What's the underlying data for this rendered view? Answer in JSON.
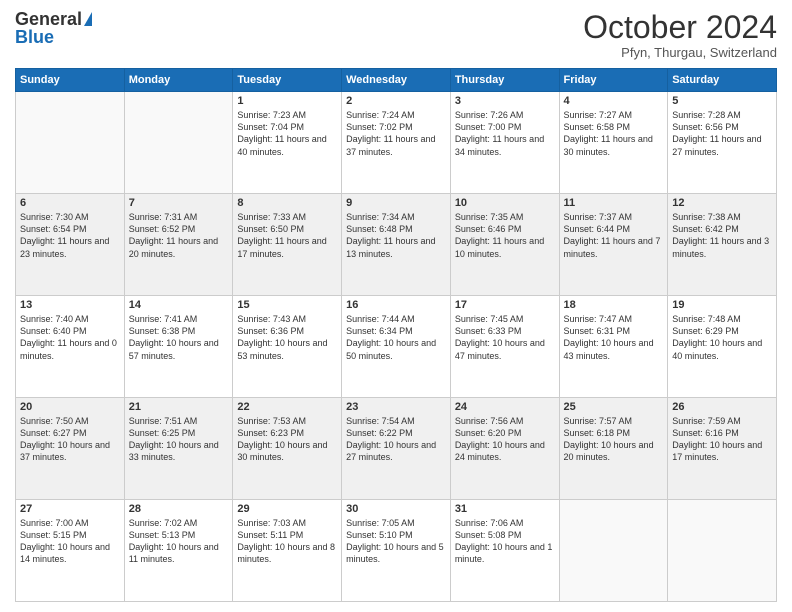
{
  "logo": {
    "general": "General",
    "blue": "Blue"
  },
  "header": {
    "month": "October 2024",
    "location": "Pfyn, Thurgau, Switzerland"
  },
  "weekdays": [
    "Sunday",
    "Monday",
    "Tuesday",
    "Wednesday",
    "Thursday",
    "Friday",
    "Saturday"
  ],
  "weeks": [
    [
      {
        "day": "",
        "info": ""
      },
      {
        "day": "",
        "info": ""
      },
      {
        "day": "1",
        "info": "Sunrise: 7:23 AM\nSunset: 7:04 PM\nDaylight: 11 hours and 40 minutes."
      },
      {
        "day": "2",
        "info": "Sunrise: 7:24 AM\nSunset: 7:02 PM\nDaylight: 11 hours and 37 minutes."
      },
      {
        "day": "3",
        "info": "Sunrise: 7:26 AM\nSunset: 7:00 PM\nDaylight: 11 hours and 34 minutes."
      },
      {
        "day": "4",
        "info": "Sunrise: 7:27 AM\nSunset: 6:58 PM\nDaylight: 11 hours and 30 minutes."
      },
      {
        "day": "5",
        "info": "Sunrise: 7:28 AM\nSunset: 6:56 PM\nDaylight: 11 hours and 27 minutes."
      }
    ],
    [
      {
        "day": "6",
        "info": "Sunrise: 7:30 AM\nSunset: 6:54 PM\nDaylight: 11 hours and 23 minutes."
      },
      {
        "day": "7",
        "info": "Sunrise: 7:31 AM\nSunset: 6:52 PM\nDaylight: 11 hours and 20 minutes."
      },
      {
        "day": "8",
        "info": "Sunrise: 7:33 AM\nSunset: 6:50 PM\nDaylight: 11 hours and 17 minutes."
      },
      {
        "day": "9",
        "info": "Sunrise: 7:34 AM\nSunset: 6:48 PM\nDaylight: 11 hours and 13 minutes."
      },
      {
        "day": "10",
        "info": "Sunrise: 7:35 AM\nSunset: 6:46 PM\nDaylight: 11 hours and 10 minutes."
      },
      {
        "day": "11",
        "info": "Sunrise: 7:37 AM\nSunset: 6:44 PM\nDaylight: 11 hours and 7 minutes."
      },
      {
        "day": "12",
        "info": "Sunrise: 7:38 AM\nSunset: 6:42 PM\nDaylight: 11 hours and 3 minutes."
      }
    ],
    [
      {
        "day": "13",
        "info": "Sunrise: 7:40 AM\nSunset: 6:40 PM\nDaylight: 11 hours and 0 minutes."
      },
      {
        "day": "14",
        "info": "Sunrise: 7:41 AM\nSunset: 6:38 PM\nDaylight: 10 hours and 57 minutes."
      },
      {
        "day": "15",
        "info": "Sunrise: 7:43 AM\nSunset: 6:36 PM\nDaylight: 10 hours and 53 minutes."
      },
      {
        "day": "16",
        "info": "Sunrise: 7:44 AM\nSunset: 6:34 PM\nDaylight: 10 hours and 50 minutes."
      },
      {
        "day": "17",
        "info": "Sunrise: 7:45 AM\nSunset: 6:33 PM\nDaylight: 10 hours and 47 minutes."
      },
      {
        "day": "18",
        "info": "Sunrise: 7:47 AM\nSunset: 6:31 PM\nDaylight: 10 hours and 43 minutes."
      },
      {
        "day": "19",
        "info": "Sunrise: 7:48 AM\nSunset: 6:29 PM\nDaylight: 10 hours and 40 minutes."
      }
    ],
    [
      {
        "day": "20",
        "info": "Sunrise: 7:50 AM\nSunset: 6:27 PM\nDaylight: 10 hours and 37 minutes."
      },
      {
        "day": "21",
        "info": "Sunrise: 7:51 AM\nSunset: 6:25 PM\nDaylight: 10 hours and 33 minutes."
      },
      {
        "day": "22",
        "info": "Sunrise: 7:53 AM\nSunset: 6:23 PM\nDaylight: 10 hours and 30 minutes."
      },
      {
        "day": "23",
        "info": "Sunrise: 7:54 AM\nSunset: 6:22 PM\nDaylight: 10 hours and 27 minutes."
      },
      {
        "day": "24",
        "info": "Sunrise: 7:56 AM\nSunset: 6:20 PM\nDaylight: 10 hours and 24 minutes."
      },
      {
        "day": "25",
        "info": "Sunrise: 7:57 AM\nSunset: 6:18 PM\nDaylight: 10 hours and 20 minutes."
      },
      {
        "day": "26",
        "info": "Sunrise: 7:59 AM\nSunset: 6:16 PM\nDaylight: 10 hours and 17 minutes."
      }
    ],
    [
      {
        "day": "27",
        "info": "Sunrise: 7:00 AM\nSunset: 5:15 PM\nDaylight: 10 hours and 14 minutes."
      },
      {
        "day": "28",
        "info": "Sunrise: 7:02 AM\nSunset: 5:13 PM\nDaylight: 10 hours and 11 minutes."
      },
      {
        "day": "29",
        "info": "Sunrise: 7:03 AM\nSunset: 5:11 PM\nDaylight: 10 hours and 8 minutes."
      },
      {
        "day": "30",
        "info": "Sunrise: 7:05 AM\nSunset: 5:10 PM\nDaylight: 10 hours and 5 minutes."
      },
      {
        "day": "31",
        "info": "Sunrise: 7:06 AM\nSunset: 5:08 PM\nDaylight: 10 hours and 1 minute."
      },
      {
        "day": "",
        "info": ""
      },
      {
        "day": "",
        "info": ""
      }
    ]
  ]
}
